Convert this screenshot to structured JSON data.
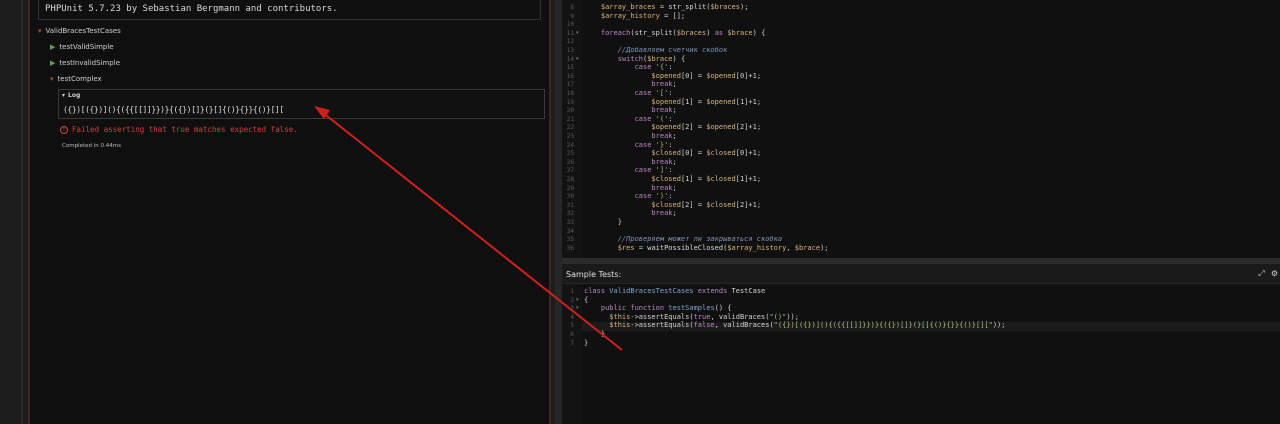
{
  "left": {
    "phpunit_banner": "PHPUnit 5.7.23 by Sebastian Bergmann and contributors.",
    "suite_label": "ValidBracesTestCases",
    "tests": [
      {
        "label": "testValidSimple",
        "state": "passed"
      },
      {
        "label": "testInvalidSimple",
        "state": "passed"
      },
      {
        "label": "testComplex",
        "state": "failed"
      }
    ],
    "log": {
      "title": "Log",
      "content": "({})[({})](){({{[[]]}})}{({})[]}(}[]{()}{}}{()}[]["
    },
    "failure_message": "Failed asserting that true matches expected false.",
    "completed_text": "Completed in 0.44ms"
  },
  "editor_top": {
    "lines": [
      {
        "n": "8",
        "fold": false,
        "tokens": [
          [
            "c-var",
            "    $array_braces"
          ],
          [
            "c-pl",
            " = "
          ],
          [
            "c-fn",
            "str_split"
          ],
          [
            "c-pl",
            "("
          ],
          [
            "c-var",
            "$braces"
          ],
          [
            "c-pl",
            ");"
          ]
        ]
      },
      {
        "n": "9",
        "fold": false,
        "tokens": [
          [
            "c-var",
            "    $array_history"
          ],
          [
            "c-pl",
            " = [];"
          ]
        ]
      },
      {
        "n": "10",
        "fold": false,
        "tokens": []
      },
      {
        "n": "11",
        "fold": true,
        "tokens": [
          [
            "c-kw",
            "    foreach"
          ],
          [
            "c-pl",
            "("
          ],
          [
            "c-fn",
            "str_split"
          ],
          [
            "c-pl",
            "("
          ],
          [
            "c-var",
            "$braces"
          ],
          [
            "c-pl",
            ") "
          ],
          [
            "c-kw",
            "as"
          ],
          [
            "c-var",
            " $brace"
          ],
          [
            "c-pl",
            ") {"
          ]
        ]
      },
      {
        "n": "12",
        "fold": false,
        "tokens": []
      },
      {
        "n": "13",
        "fold": false,
        "tokens": [
          [
            "c-cm",
            "        //Добавляем счетчик скобок"
          ]
        ]
      },
      {
        "n": "14",
        "fold": true,
        "tokens": [
          [
            "c-kw",
            "        switch"
          ],
          [
            "c-pl",
            "("
          ],
          [
            "c-var",
            "$brace"
          ],
          [
            "c-pl",
            ") {"
          ]
        ]
      },
      {
        "n": "15",
        "fold": false,
        "tokens": [
          [
            "c-kw",
            "            case "
          ],
          [
            "c-str",
            "'{'"
          ],
          [
            "c-pl",
            ":"
          ]
        ]
      },
      {
        "n": "16",
        "fold": false,
        "tokens": [
          [
            "c-var",
            "                $opened"
          ],
          [
            "c-pl",
            "["
          ],
          [
            "c-num",
            "0"
          ],
          [
            "c-pl",
            "] = "
          ],
          [
            "c-var",
            "$opened"
          ],
          [
            "c-pl",
            "["
          ],
          [
            "c-num",
            "0"
          ],
          [
            "c-pl",
            "]+"
          ],
          [
            "c-num",
            "1"
          ],
          [
            "c-pl",
            ";"
          ]
        ]
      },
      {
        "n": "17",
        "fold": false,
        "tokens": [
          [
            "c-kw",
            "                break"
          ],
          [
            "c-pl",
            ";"
          ]
        ]
      },
      {
        "n": "18",
        "fold": false,
        "tokens": [
          [
            "c-kw",
            "            case "
          ],
          [
            "c-str",
            "'['"
          ],
          [
            "c-pl",
            ":"
          ]
        ]
      },
      {
        "n": "19",
        "fold": false,
        "tokens": [
          [
            "c-var",
            "                $opened"
          ],
          [
            "c-pl",
            "["
          ],
          [
            "c-num",
            "1"
          ],
          [
            "c-pl",
            "] = "
          ],
          [
            "c-var",
            "$opened"
          ],
          [
            "c-pl",
            "["
          ],
          [
            "c-num",
            "1"
          ],
          [
            "c-pl",
            "]+"
          ],
          [
            "c-num",
            "1"
          ],
          [
            "c-pl",
            ";"
          ]
        ]
      },
      {
        "n": "20",
        "fold": false,
        "tokens": [
          [
            "c-kw",
            "                break"
          ],
          [
            "c-pl",
            ";"
          ]
        ]
      },
      {
        "n": "21",
        "fold": false,
        "tokens": [
          [
            "c-kw",
            "            case "
          ],
          [
            "c-str",
            "'('"
          ],
          [
            "c-pl",
            ":"
          ]
        ]
      },
      {
        "n": "22",
        "fold": false,
        "tokens": [
          [
            "c-var",
            "                $opened"
          ],
          [
            "c-pl",
            "["
          ],
          [
            "c-num",
            "2"
          ],
          [
            "c-pl",
            "] = "
          ],
          [
            "c-var",
            "$opened"
          ],
          [
            "c-pl",
            "["
          ],
          [
            "c-num",
            "2"
          ],
          [
            "c-pl",
            "]+"
          ],
          [
            "c-num",
            "1"
          ],
          [
            "c-pl",
            ";"
          ]
        ]
      },
      {
        "n": "23",
        "fold": false,
        "tokens": [
          [
            "c-kw",
            "                break"
          ],
          [
            "c-pl",
            ";"
          ]
        ]
      },
      {
        "n": "24",
        "fold": false,
        "tokens": [
          [
            "c-kw",
            "            case "
          ],
          [
            "c-str",
            "'}'"
          ],
          [
            "c-pl",
            ":"
          ]
        ]
      },
      {
        "n": "25",
        "fold": false,
        "tokens": [
          [
            "c-var",
            "                $closed"
          ],
          [
            "c-pl",
            "["
          ],
          [
            "c-num",
            "0"
          ],
          [
            "c-pl",
            "] = "
          ],
          [
            "c-var",
            "$closed"
          ],
          [
            "c-pl",
            "["
          ],
          [
            "c-num",
            "0"
          ],
          [
            "c-pl",
            "]+"
          ],
          [
            "c-num",
            "1"
          ],
          [
            "c-pl",
            ";"
          ]
        ]
      },
      {
        "n": "26",
        "fold": false,
        "tokens": [
          [
            "c-kw",
            "                break"
          ],
          [
            "c-pl",
            ";"
          ]
        ]
      },
      {
        "n": "27",
        "fold": false,
        "tokens": [
          [
            "c-kw",
            "            case "
          ],
          [
            "c-str",
            "']'"
          ],
          [
            "c-pl",
            ":"
          ]
        ]
      },
      {
        "n": "28",
        "fold": false,
        "tokens": [
          [
            "c-var",
            "                $closed"
          ],
          [
            "c-pl",
            "["
          ],
          [
            "c-num",
            "1"
          ],
          [
            "c-pl",
            "] = "
          ],
          [
            "c-var",
            "$closed"
          ],
          [
            "c-pl",
            "["
          ],
          [
            "c-num",
            "1"
          ],
          [
            "c-pl",
            "]+"
          ],
          [
            "c-num",
            "1"
          ],
          [
            "c-pl",
            ";"
          ]
        ]
      },
      {
        "n": "29",
        "fold": false,
        "tokens": [
          [
            "c-kw",
            "                break"
          ],
          [
            "c-pl",
            ";"
          ]
        ]
      },
      {
        "n": "30",
        "fold": false,
        "tokens": [
          [
            "c-kw",
            "            case "
          ],
          [
            "c-str",
            "')'"
          ],
          [
            "c-pl",
            ":"
          ]
        ]
      },
      {
        "n": "31",
        "fold": false,
        "tokens": [
          [
            "c-var",
            "                $closed"
          ],
          [
            "c-pl",
            "["
          ],
          [
            "c-num",
            "2"
          ],
          [
            "c-pl",
            "] = "
          ],
          [
            "c-var",
            "$closed"
          ],
          [
            "c-pl",
            "["
          ],
          [
            "c-num",
            "2"
          ],
          [
            "c-pl",
            "]+"
          ],
          [
            "c-num",
            "1"
          ],
          [
            "c-pl",
            ";"
          ]
        ]
      },
      {
        "n": "32",
        "fold": false,
        "tokens": [
          [
            "c-kw",
            "                break"
          ],
          [
            "c-pl",
            ";"
          ]
        ]
      },
      {
        "n": "33",
        "fold": false,
        "tokens": [
          [
            "c-pl",
            "        }"
          ]
        ]
      },
      {
        "n": "34",
        "fold": false,
        "tokens": []
      },
      {
        "n": "35",
        "fold": false,
        "tokens": [
          [
            "c-cm",
            "        //Проверяем может ли закрываться скобка"
          ]
        ]
      },
      {
        "n": "36",
        "fold": false,
        "tokens": [
          [
            "c-var",
            "        $res"
          ],
          [
            "c-pl",
            " = "
          ],
          [
            "c-fn",
            "waitPossibleClosed"
          ],
          [
            "c-pl",
            "("
          ],
          [
            "c-var",
            "$array_history"
          ],
          [
            "c-pl",
            ", "
          ],
          [
            "c-var",
            "$brace"
          ],
          [
            "c-pl",
            ");"
          ]
        ]
      }
    ]
  },
  "sample_tests": {
    "title": "Sample Tests:",
    "icons": [
      "expand-icon",
      "settings-icon",
      "collapse-icon"
    ],
    "lines": [
      {
        "n": "1",
        "fold": false,
        "tokens": [
          [
            "c-kw",
            "class "
          ],
          [
            "c-ent",
            "ValidBracesTestCases"
          ],
          [
            "c-kw",
            " extends "
          ],
          [
            "c-pl",
            "TestCase"
          ]
        ]
      },
      {
        "n": "2",
        "fold": true,
        "tokens": [
          [
            "c-pl",
            "{"
          ]
        ]
      },
      {
        "n": "3",
        "fold": true,
        "tokens": [
          [
            "c-kw",
            "    public function "
          ],
          [
            "c-ent",
            "testSamples"
          ],
          [
            "c-pl",
            "() {"
          ]
        ]
      },
      {
        "n": "4",
        "fold": false,
        "tokens": [
          [
            "c-var",
            "      $this"
          ],
          [
            "c-pl",
            "->assertEquals("
          ],
          [
            "c-kw",
            "true"
          ],
          [
            "c-pl",
            ", validBraces("
          ],
          [
            "c-str",
            "\"()\""
          ],
          [
            "c-pl",
            "));"
          ]
        ]
      },
      {
        "n": "5",
        "fold": false,
        "tokens": [
          [
            "c-var",
            "      $this"
          ],
          [
            "c-pl",
            "->assertEquals("
          ],
          [
            "c-kw",
            "false"
          ],
          [
            "c-pl",
            ", validBraces("
          ],
          [
            "c-str",
            "\"({})[({})](){({{[[]]}})}{({})[]}(}[]{()}{}}{()}[][\""
          ],
          [
            "c-pl",
            "));"
          ]
        ]
      },
      {
        "n": "6",
        "fold": false,
        "tokens": [
          [
            "c-pl",
            "    }"
          ]
        ]
      },
      {
        "n": "7",
        "fold": false,
        "tokens": [
          [
            "c-pl",
            "}"
          ]
        ]
      }
    ]
  },
  "colors": {
    "failure_red": "#c8443a",
    "pass_green": "#5ea84a",
    "arrow_red": "#d0201c"
  }
}
